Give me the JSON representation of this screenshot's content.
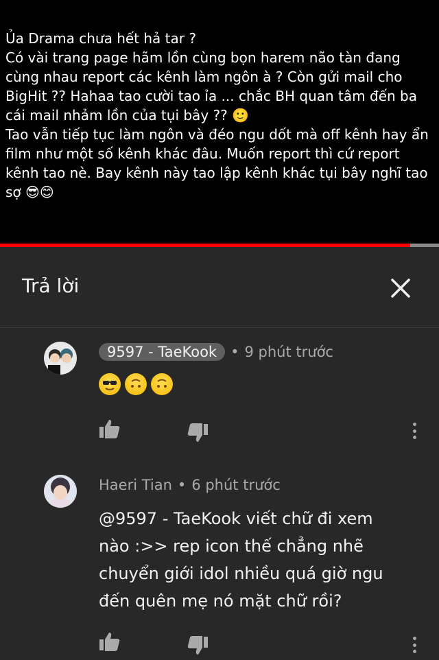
{
  "video": {
    "overlay_text": "Ủa Drama chưa hết hả tar ?\nCó vài trang page hãm lồn cùng bọn harem não tàn đang cùng nhau report các kênh làm ngôn à ? Còn gửi mail cho BigHit ?? Hahaa tao cười tao ỉa ... chắc BH quan tâm đến ba cái mail nhảm lồn của tụi bây ?? 🙂\nTao vẫn tiếp tục làm ngôn và đéo ngu dốt mà off kênh hay ẩn film như một số kênh khác đâu. Muốn report thì cứ report kênh tao nè. Bay kênh này tao lập kênh khác tụi bây nghĩ tao sợ 😎😊",
    "progress": 0.935,
    "progress_color": "#ff0000"
  },
  "reply_panel": {
    "title": "Trả lời",
    "close_icon": "close-icon"
  },
  "comments": [
    {
      "author": "9597 - TaeKook",
      "separator": "•",
      "time": "9 phút trước",
      "emojis": [
        "😎",
        "🙃",
        "🙃"
      ],
      "highlighted_author": true
    },
    {
      "author": "Haeri Tian",
      "separator": "•",
      "time": "6 phút trước",
      "text": "@9597 - TaeKook viết chữ đi xem nào :>> rep icon thế chẳng nhẽ chuyển giới idol nhiều quá giờ ngu đến quên mẹ nó mặt chữ rồi?",
      "highlighted_author": false
    }
  ]
}
